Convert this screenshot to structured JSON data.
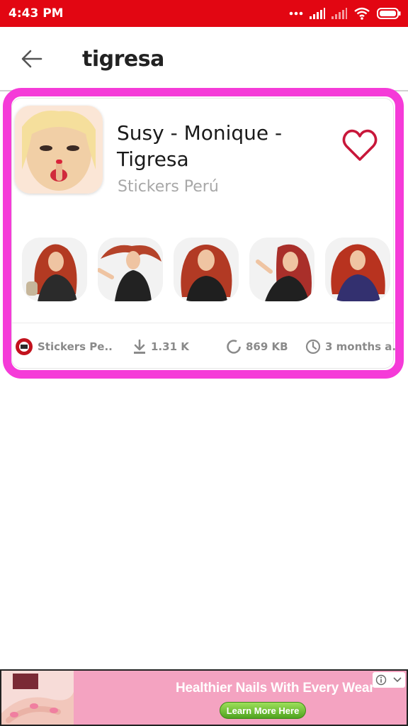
{
  "status_bar": {
    "time": "4:43 PM",
    "icons": [
      "more-dots-icon",
      "signal-icon",
      "signal-icon",
      "wifi-icon",
      "battery-icon"
    ],
    "background": "#e20612"
  },
  "toolbar": {
    "back_icon": "arrow-left-icon",
    "query": "tigresa"
  },
  "result": {
    "title": "Susy - Monique - Tigresa",
    "author": "Stickers Perú",
    "favorite_icon": "heart-outline-icon",
    "stickers_count_shown": 5,
    "meta": {
      "publisher": "Stickers Pe..",
      "downloads": "1.31 K",
      "size": "869 KB",
      "updated": "3 months a.."
    },
    "highlight_color": "#f53bd8",
    "heart_color": "#c8173a"
  },
  "ad": {
    "headline": "Healthier Nails With Every Wear",
    "cta": "Learn More Here",
    "background": "#f4a3c1"
  }
}
